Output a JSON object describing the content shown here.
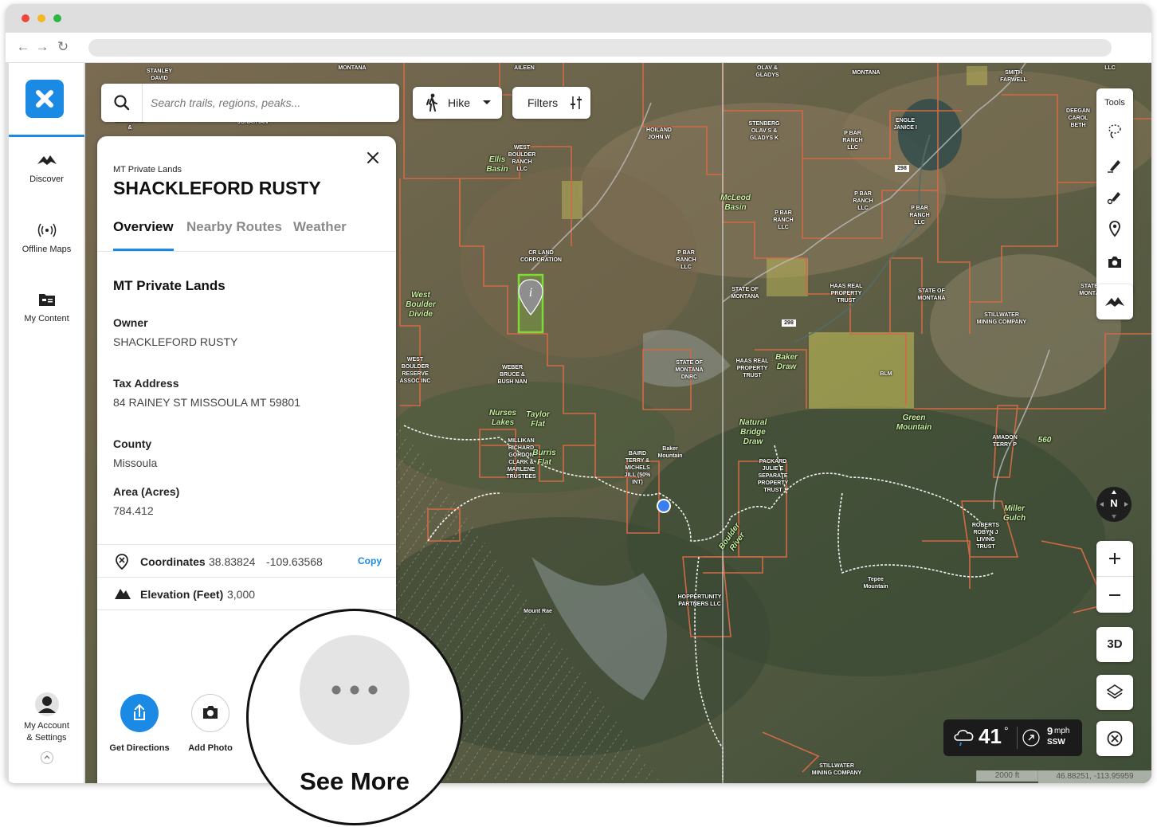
{
  "sidebar": {
    "items": [
      {
        "label": "Discover",
        "icon": "discover-icon"
      },
      {
        "label": "Offline Maps",
        "icon": "offline-maps-icon"
      },
      {
        "label": "My Content",
        "icon": "my-content-icon"
      }
    ],
    "account": {
      "label": "My Account & Settings",
      "line1": "My Account",
      "line2": "& Settings",
      "icon": "avatar-icon"
    }
  },
  "search": {
    "placeholder": "Search trails, regions, peaks..."
  },
  "activity": {
    "label": "Hike",
    "icon": "hiker-icon"
  },
  "filters": {
    "label": "Filters"
  },
  "panel": {
    "subtitle": "MT Private Lands",
    "title": "SHACKLEFORD RUSTY",
    "tabs": [
      {
        "label": "Overview",
        "active": true
      },
      {
        "label": "Nearby Routes",
        "active": false
      },
      {
        "label": "Weather",
        "active": false
      }
    ],
    "section_title": "MT Private Lands",
    "fields": [
      {
        "label": "Owner",
        "value": "SHACKLEFORD RUSTY"
      },
      {
        "label": "Tax Address",
        "value": "84 RAINEY ST MISSOULA MT 59801"
      },
      {
        "label": "County",
        "value": "Missoula"
      },
      {
        "label": "Area (Acres)",
        "value": "784.412"
      }
    ],
    "coordinates": {
      "label": "Coordinates",
      "lat": "38.83824",
      "lon": "-109.63568",
      "copy_label": "Copy"
    },
    "elevation": {
      "label": "Elevation (Feet)",
      "value": "3,000"
    },
    "actions": [
      {
        "label": "Get Directions",
        "icon": "share-icon"
      },
      {
        "label": "Add Photo",
        "icon": "camera-icon"
      }
    ],
    "see_more": {
      "label": "See More",
      "icon": "more-dots-icon"
    }
  },
  "tools": {
    "label": "Tools"
  },
  "map_controls": {
    "three_d": "3D",
    "compass": "N"
  },
  "weather": {
    "temp": "41",
    "degree": "°",
    "wind_speed": "9",
    "wind_unit": "mph",
    "wind_dir": "SSW"
  },
  "scale": {
    "label": "2000 ft"
  },
  "cursor_coords": "46.88251, -113.95959",
  "map_labels": {
    "stanley": "STANLEY DAVID",
    "montana1": "MONTANA",
    "aileen": "AILEEN",
    "olav": "OLAV & GLADYS",
    "montana2": "MONTANA",
    "smith": "SMITH FARWELL",
    "llc1": "LLC",
    "bannus": "BANNUS B &",
    "jonathan": "JONATHAN",
    "hoiland": "HOILAND JOHN W",
    "stenberg": "STENBERG OLAV S & GLADYS K",
    "pbar1": "P BAR RANCH LLC",
    "engle": "ENGLE JANICE I",
    "deegan": "DEEGAN CAROL BETH",
    "west_boulder_ranch": "WEST BOULDER RANCH LLC",
    "ellis": "Ellis Basin",
    "pbar2": "P BAR RANCH LLC",
    "pbar3": "P BAR RANCH LLC",
    "mcleod": "McLeod Basin",
    "pbar4": "P BAR RANCH LLC",
    "cr_land": "CR LAND CORPORATION",
    "pbar5": "P BAR RANCH LLC",
    "west_boulder_divide": "West Boulder Divide",
    "state1": "STATE OF MONTANA",
    "haas1": "HAAS REAL PROPERTY TRUST",
    "state2": "STATE OF MONTANA",
    "stillwater1": "STILLWATER MINING COMPANY",
    "state3": "STATE MONTA",
    "west_boulder_reserve": "WEST BOULDER RESERVE ASSOC INC",
    "weber": "WEBER BRUCE & BUSH NAN",
    "state_dnrc": "STATE OF MONTANA DNRC",
    "haas2": "HAAS REAL PROPERTY TRUST",
    "baker_draw": "Baker Draw",
    "blm": "BLM",
    "nurses": "Nurses Lakes",
    "taylor": "Taylor Flat",
    "green_mtn": "Green Mountain",
    "amadon": "AMADON TERRY P",
    "n560": "560",
    "milliken": "MILLIKAN RICHARD GORDON CLARK & MARLENE TRUSTEES",
    "burris": "Burris Flat",
    "baird": "BAIRD TERRY & MICHELS JILL (50% INT)",
    "baker_mtn": "Baker Mountain",
    "natural_bridge": "Natural Bridge Draw",
    "packard": "PACKARD JULIE E SEPARATE PROPERTY TRUST",
    "roberts": "ROBERTS ROBYN J LIVING TRUST",
    "miller": "Miller Gulch",
    "tepee": "Tepee Mountain",
    "hoppertunity": "HOPPERTUNITY PARTNERS LLC",
    "mount_rae": "Mount Rae",
    "stillwater2": "STILLWATER MINING COMPANY",
    "boulder_river": "Boulder River",
    "r298a": "298",
    "r298b": "298"
  },
  "colors": {
    "accent": "#1a8ae5",
    "parcel_border": "#d06a45",
    "selected_parcel": "#7ddc3b",
    "blm_fill": "#c9c45a"
  }
}
